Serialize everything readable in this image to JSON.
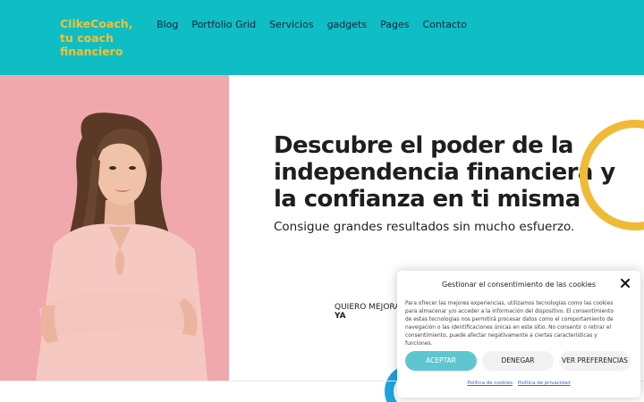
{
  "header": {
    "logo": "ClikeCoach, tu coach financiero",
    "nav": [
      "Blog",
      "Portfolio Grid",
      "Servicios",
      "gadgets",
      "Pages",
      "Contacto"
    ]
  },
  "hero": {
    "title": "Descubre el poder de la independencia financiera y la confianza en ti misma",
    "subtitle": "Consigue grandes resultados sin mucho esfuerzo.",
    "cta_line1": "QUIERO MEJORAR",
    "cta_line2": "YA"
  },
  "consent": {
    "title": "Gestionar el consentimiento de las cookies",
    "body": "Para ofrecer las mejores experiencias, utilizamos tecnologías como las cookies para almacenar y/o acceder a la información del dispositivo. El consentimiento de estas tecnologías nos permitirá procesar datos como el comportamiento de navegación o las identificaciones únicas en este sitio. No consentir o retirar el consentimiento, puede afectar negativamente a ciertas características y funciones.",
    "accept_label": "ACEPTAR",
    "deny_label": "DENEGAR",
    "prefs_label": "VER PREFERENCIAS",
    "cookie_policy_link": "Política de cookies",
    "privacy_policy_link": "Política de privacidad"
  },
  "colors": {
    "header_bg": "#0fbec4",
    "logo": "#f2c136",
    "photo_bg": "#f0a8ad",
    "ring": "#efba36",
    "accept_button": "#5fc6d0"
  }
}
